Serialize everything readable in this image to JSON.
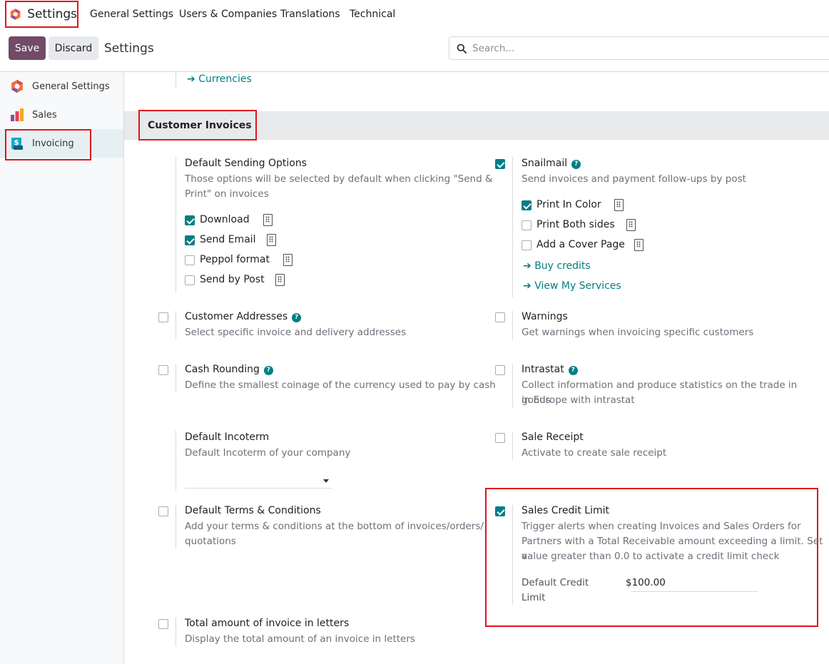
{
  "app": {
    "name": "Settings"
  },
  "menu": [
    "General Settings",
    "Users & Companies",
    "Translations",
    "Technical"
  ],
  "control_panel": {
    "save": "Save",
    "discard": "Discard",
    "breadcrumb": "Settings",
    "search_placeholder": "Search..."
  },
  "sidebar": [
    {
      "label": "General Settings",
      "icon": "odoo-logo-icon"
    },
    {
      "label": "Sales",
      "icon": "sales-app-icon"
    },
    {
      "label": "Invoicing",
      "icon": "invoicing-app-icon",
      "active": true
    }
  ],
  "currencies_link": "Currencies",
  "section_title": "Customer Invoices",
  "settings": {
    "default_sending": {
      "title": "Default Sending Options",
      "desc_1": "Those options will be selected by default when clicking \"Send &",
      "desc_2": "Print\" on invoices",
      "options": [
        {
          "label": "Download",
          "checked": true
        },
        {
          "label": "Send Email",
          "checked": true
        },
        {
          "label": "Peppol format",
          "checked": false
        },
        {
          "label": "Send by Post",
          "checked": false
        }
      ]
    },
    "snailmail": {
      "title": "Snailmail",
      "checked": true,
      "desc": "Send invoices and payment follow-ups by post",
      "options": [
        {
          "label": "Print In Color",
          "checked": true
        },
        {
          "label": "Print Both sides",
          "checked": false
        },
        {
          "label": "Add a Cover Page",
          "checked": false
        }
      ],
      "links": [
        "Buy credits",
        "View My Services"
      ]
    },
    "customer_addresses": {
      "title": "Customer Addresses",
      "desc": "Select specific invoice and delivery addresses",
      "checked": false
    },
    "warnings": {
      "title": "Warnings",
      "desc": "Get warnings when invoicing specific customers",
      "checked": false
    },
    "cash_rounding": {
      "title": "Cash Rounding",
      "desc": "Define the smallest coinage of the currency used to pay by cash",
      "checked": false
    },
    "intrastat": {
      "title": "Intrastat",
      "desc_1": "Collect information and produce statistics on the trade in goods",
      "desc_2": "in Europe with intrastat",
      "checked": false
    },
    "default_incoterm": {
      "title": "Default Incoterm",
      "desc": "Default Incoterm of your company",
      "value": ""
    },
    "sale_receipt": {
      "title": "Sale Receipt",
      "desc": "Activate to create sale receipt",
      "checked": false
    },
    "default_terms": {
      "title": "Default Terms & Conditions",
      "desc_1": "Add your terms & conditions at the bottom of invoices/orders/",
      "desc_2": "quotations",
      "checked": false
    },
    "sales_credit_limit": {
      "title": "Sales Credit Limit",
      "checked": true,
      "desc_1": "Trigger alerts when creating Invoices and Sales Orders for",
      "desc_2": "Partners with a Total Receivable amount exceeding a limit. Set a",
      "desc_3": "value greater than 0.0 to activate a credit limit check",
      "field_label_1": "Default Credit",
      "field_label_2": "Limit",
      "field_value": "$100.00"
    },
    "total_in_letters": {
      "title": "Total amount of invoice in letters",
      "desc": "Display the total amount of an invoice in letters",
      "checked": false
    }
  },
  "colors": {
    "primary": "#714b67",
    "accent": "#017e84",
    "highlight": "#e0141e"
  }
}
